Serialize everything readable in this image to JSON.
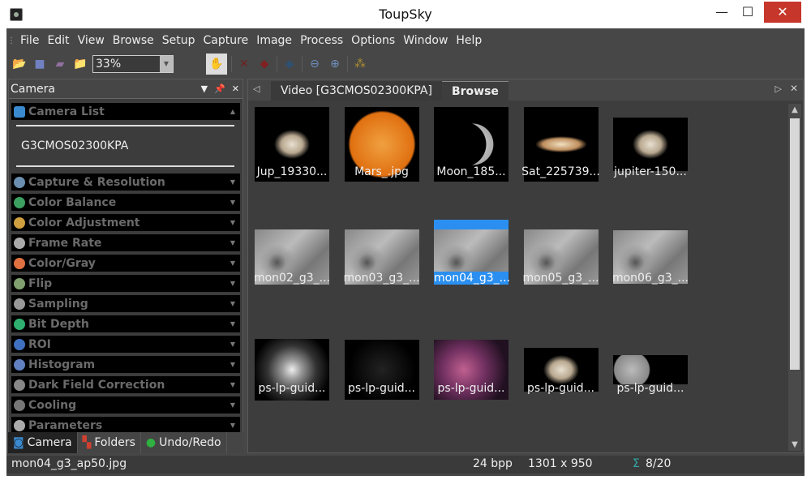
{
  "window": {
    "title": "ToupSky",
    "minimize": "—",
    "maximize": "☐",
    "close": "✕"
  },
  "menu": [
    "File",
    "Edit",
    "View",
    "Browse",
    "Setup",
    "Capture",
    "Image",
    "Process",
    "Options",
    "Window",
    "Help"
  ],
  "toolbar": {
    "zoom_value": "33%"
  },
  "camera_panel": {
    "title": "Camera",
    "camera_list_label": "Camera List",
    "camera_name": "G3CMOS02300KPA",
    "sections": [
      {
        "label": "Capture & Resolution",
        "color": "#6a8fb0"
      },
      {
        "label": "Color Balance",
        "color": "#3ca060"
      },
      {
        "label": "Color Adjustment",
        "color": "#d0a040"
      },
      {
        "label": "Frame Rate",
        "color": "#aaaaaa"
      },
      {
        "label": "Color/Gray",
        "color": "#e07040"
      },
      {
        "label": "Flip",
        "color": "#80a070"
      },
      {
        "label": "Sampling",
        "color": "#999999"
      },
      {
        "label": "Bit Depth",
        "color": "#30b070"
      },
      {
        "label": "ROI",
        "color": "#4070c0"
      },
      {
        "label": "Histogram",
        "color": "#6080c0"
      },
      {
        "label": "Dark Field Correction",
        "color": "#888888"
      },
      {
        "label": "Cooling",
        "color": "#777777"
      },
      {
        "label": "Parameters",
        "color": "#aaaaaa"
      }
    ]
  },
  "bottom_tabs": [
    "Camera",
    "Folders",
    "Undo/Redo"
  ],
  "doc_tabs": {
    "video": "Video [G3CMOS02300KPA]",
    "browse": "Browse"
  },
  "thumbnails": [
    {
      "label": "Jup_19330...",
      "kind": "jupiter"
    },
    {
      "label": "Mars_.jpg",
      "kind": "sun"
    },
    {
      "label": "Moon_185...",
      "kind": "crescent"
    },
    {
      "label": "Sat_225739...",
      "kind": "saturn"
    },
    {
      "label": "jupiter-150...",
      "kind": "jupiter"
    },
    {
      "label": "mon02_g3_...",
      "kind": "moon"
    },
    {
      "label": "mon03_g3_...",
      "kind": "moon"
    },
    {
      "label": "mon04_g3_...",
      "kind": "moon",
      "selected": true
    },
    {
      "label": "mon05_g3_...",
      "kind": "moon"
    },
    {
      "label": "mon06_g3_...",
      "kind": "moon"
    },
    {
      "label": "ps-lp-guid...",
      "kind": "cluster"
    },
    {
      "label": "ps-lp-guid...",
      "kind": "dark"
    },
    {
      "label": "ps-lp-guid...",
      "kind": "nebula"
    },
    {
      "label": "ps-lp-guid...",
      "kind": "jupiter"
    },
    {
      "label": "ps-lp-guid...",
      "kind": "phases"
    }
  ],
  "status": {
    "filename": "mon04_g3_ap50.jpg",
    "bpp": "24 bpp",
    "dimensions": "1301 x 950",
    "count": "8/20"
  }
}
